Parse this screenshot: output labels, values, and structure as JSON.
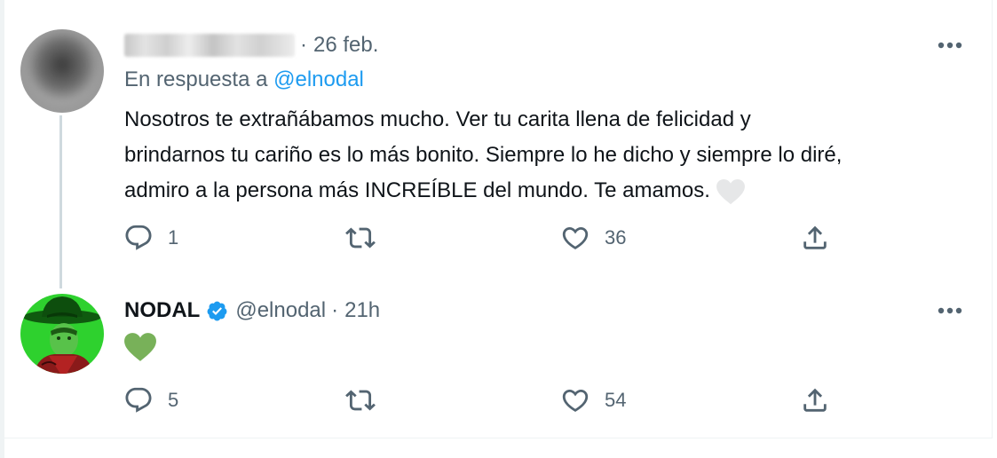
{
  "tweets": [
    {
      "name": "",
      "handle": "",
      "date": "26 feb.",
      "reply_to_label": "En respuesta a",
      "reply_to_handle": "@elnodal",
      "text_lines": [
        "Nosotros te extrañábamos mucho. Ver tu carita llena de felicidad y",
        "brindarnos tu cariño es lo más bonito. Siempre lo he dicho y siempre lo diré,",
        "admiro a la persona más INCREÍBLE del mundo. Te amamos."
      ],
      "emoji": "white-heart",
      "reply_count": "1",
      "retweet_count": "",
      "like_count": "36"
    },
    {
      "name": "NODAL",
      "handle": "@elnodal",
      "date": "21h",
      "emoji": "green-heart",
      "reply_count": "5",
      "retweet_count": "",
      "like_count": "54"
    }
  ],
  "separator": "·",
  "colors": {
    "accent": "#1d9bf0",
    "muted": "#536471",
    "text": "#0f1419",
    "thread_line": "#cfd9de",
    "green_heart": "#78b159"
  }
}
